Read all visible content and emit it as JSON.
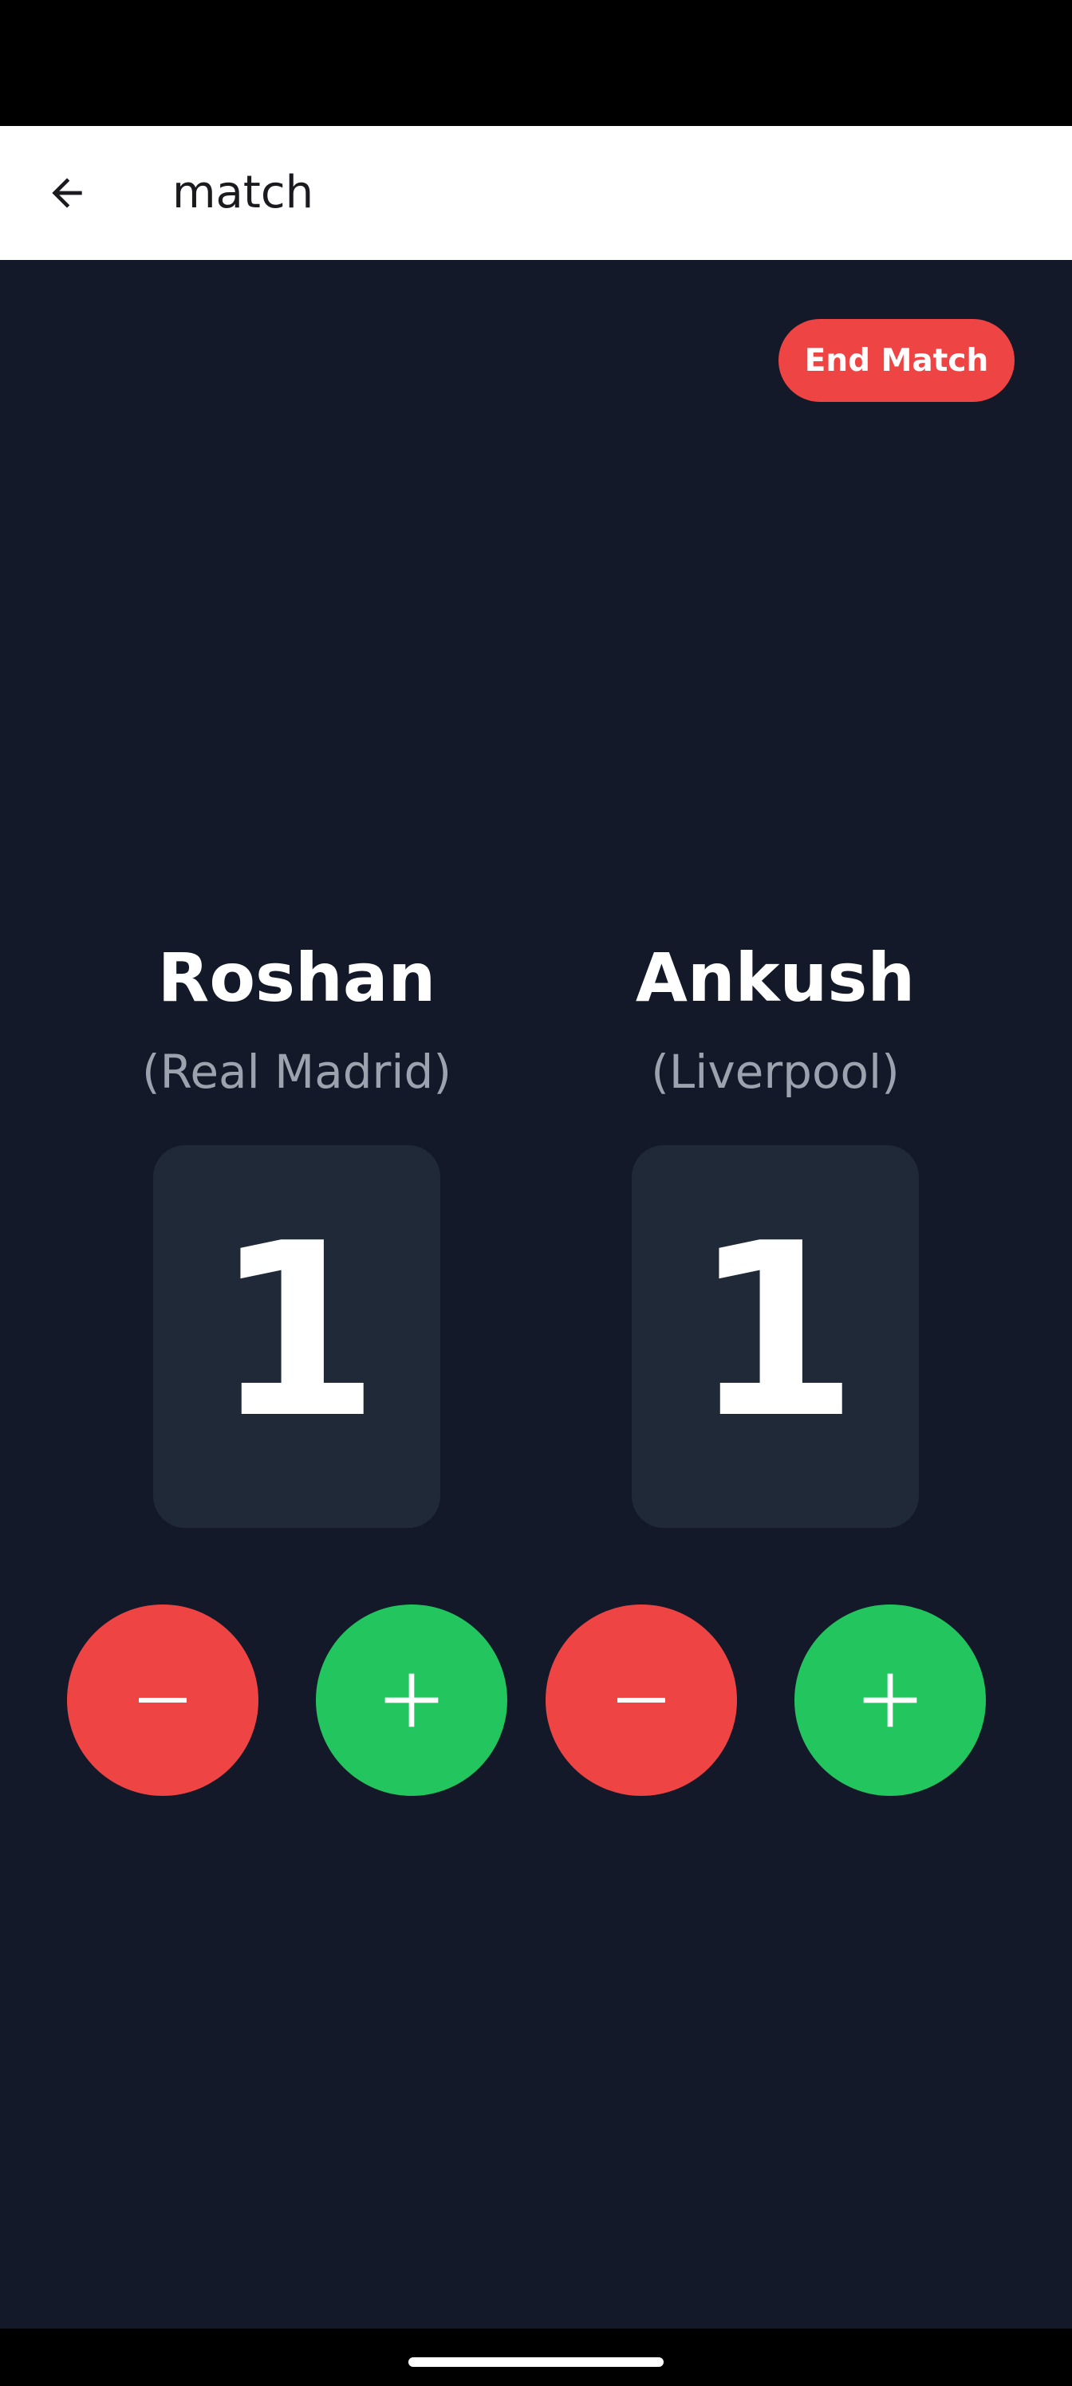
{
  "app_bar": {
    "title": "match",
    "back_icon": "arrow-back-icon"
  },
  "actions": {
    "end_match_label": "End Match"
  },
  "players": [
    {
      "name": "Roshan",
      "team": "(Real Madrid)",
      "score": "1"
    },
    {
      "name": "Ankush",
      "team": "(Liverpool)",
      "score": "1"
    }
  ],
  "controls": {
    "minus_icon": "minus-icon",
    "plus_icon": "plus-icon"
  },
  "colors": {
    "background": "#131928",
    "card": "#1f2937",
    "danger": "#ef4444",
    "success": "#22c55e",
    "muted_text": "#9ca3af"
  }
}
